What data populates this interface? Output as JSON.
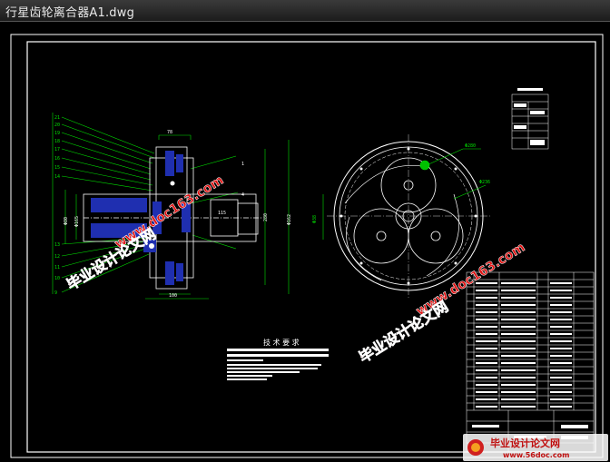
{
  "window": {
    "title": "行星齿轮离合器A1.dwg"
  },
  "drawing": {
    "tech_req_title": "技 术 要 求",
    "ring_dims": [
      "Φ280",
      "Φ236",
      "Φ38"
    ],
    "left_dims": [
      "Φ80",
      "Φ165",
      "Φ210",
      "78",
      "115",
      "280",
      "Φ162",
      "100",
      "300"
    ],
    "part_numbers": [
      "21",
      "20",
      "19",
      "18",
      "17",
      "16",
      "15",
      "14",
      "13",
      "12",
      "11",
      "10",
      "9",
      "8"
    ],
    "right_numbers": [
      "1",
      "2",
      "3",
      "4",
      "5",
      "6",
      "7"
    ]
  },
  "watermarks": {
    "url": "www.doc163.com",
    "cn_text": "毕业设计论文网"
  },
  "footer": {
    "cn_text": "毕业设计论文网",
    "url": "www.56doc.com"
  },
  "colors": {
    "background": "#000000",
    "frame": "#ffffff",
    "dim_lines": "#00ff00",
    "parts_blue": "#1f2fb0",
    "watermark_red": "#e01010"
  }
}
